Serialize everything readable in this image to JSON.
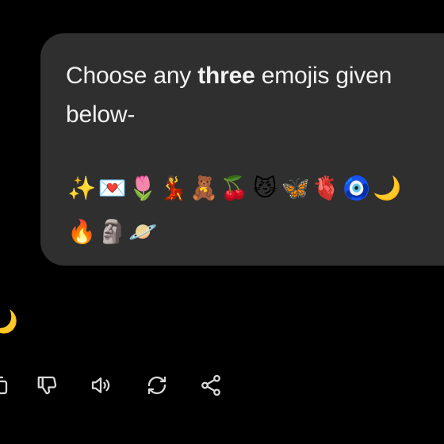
{
  "message": {
    "prefix": "Choose any ",
    "bold": "three",
    "suffix": " emojis given below-"
  },
  "emojis_row1": [
    "✨",
    "💌",
    "🌷",
    "💃",
    "🧸",
    "🍒",
    "😼",
    "🦋",
    "🫀",
    "🧿",
    "🌙"
  ],
  "emojis_row2": [
    "🔥",
    "🗿",
    "🪐"
  ],
  "partial_reply_emoji": "🌙",
  "actions": [
    {
      "name": "copy-button",
      "icon": "copy-icon"
    },
    {
      "name": "thumbs-down-button",
      "icon": "thumbs-down-icon"
    },
    {
      "name": "read-aloud-button",
      "icon": "speaker-icon"
    },
    {
      "name": "regenerate-button",
      "icon": "refresh-icon"
    },
    {
      "name": "share-button",
      "icon": "share-icon"
    }
  ],
  "colors": {
    "background": "#000000",
    "bubble": "#2f2f2f",
    "text": "#f2f2f2",
    "icon": "#d9d9d9"
  }
}
